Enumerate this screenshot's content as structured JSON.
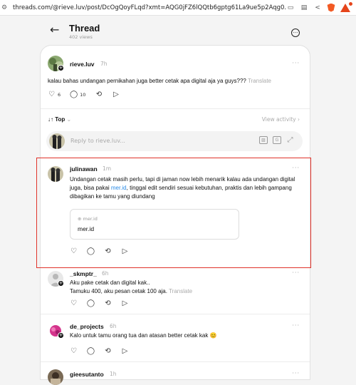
{
  "browser": {
    "url": "threads.com/@rieve.luv/post/DcOgQoyFLqd?xmt=AQG0jFZ6lQQtb6gptg61La9ue5p2Aqg0..."
  },
  "page": {
    "title": "Thread",
    "views": "402 views"
  },
  "post": {
    "username": "rieve.luv",
    "time": "7h",
    "text": "kalau bahas undangan pernikahan juga better cetak apa digital aja ya guys???",
    "translate": "Translate",
    "likes": "6",
    "replies": "10"
  },
  "sort": {
    "label": "Top",
    "view_activity": "View activity ›"
  },
  "reply_box": {
    "placeholder": "Reply to rieve.luv..."
  },
  "comments": [
    {
      "username": "julinawan",
      "time": "1m",
      "text_before": "Undangan cetak masih perlu, tapi di jaman now lebih menarik kalau ada undangan digital juga, bisa pakai ",
      "link": "mer.id",
      "text_after": ", tinggal edit sendiri sesuai kebutuhan, praktis dan lebih gampang dibagikan ke tamu yang diundang",
      "preview_domain": "mer.id",
      "preview_title": "mer.id"
    },
    {
      "username": "_skmptr_",
      "time": "6h",
      "line1": "Aku pake cetak dan digital kak..",
      "line2": "Tamuku 400, aku pesan cetak 100 aja.",
      "translate": "Translate"
    },
    {
      "username": "de_projects",
      "time": "6h",
      "text": "Kalo untuk tamu orang tua dan atasan better cetak kak 😊"
    },
    {
      "username": "gieesutanto",
      "time": "1h"
    }
  ],
  "icons": {
    "back": "arrow-left-icon",
    "more": "more-circle-icon",
    "like": "heart-icon",
    "reply": "comment-icon",
    "repost": "repost-icon",
    "share": "send-icon"
  },
  "colors": {
    "highlight": "#e0322a",
    "link": "#2a8be6"
  }
}
